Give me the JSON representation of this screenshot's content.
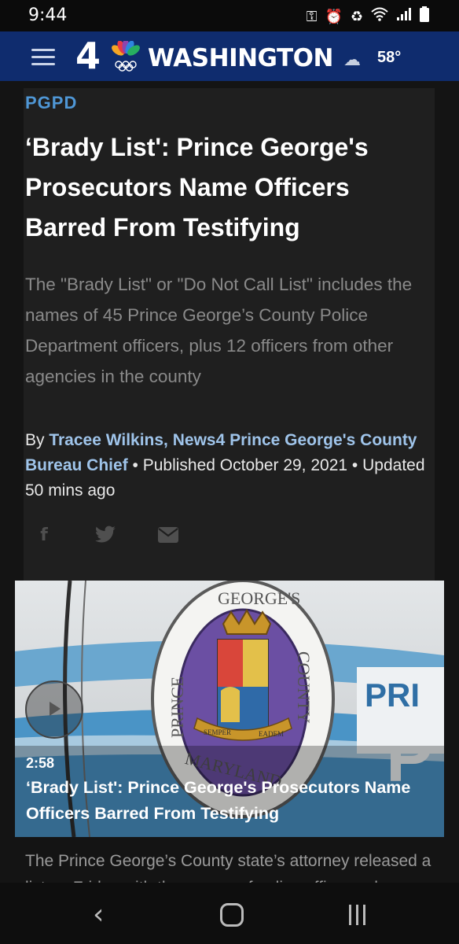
{
  "status_bar": {
    "time": "9:44",
    "icons": [
      "key-icon",
      "alarm-icon",
      "battery-saver-icon",
      "wifi-icon",
      "signal-icon",
      "battery-icon"
    ]
  },
  "header": {
    "logo_number": "4",
    "logo_text": "WASHINGTON",
    "weather_icon": "cloud-icon",
    "temperature": "58°"
  },
  "article": {
    "tag": "PGPD",
    "headline": "‘Brady List': Prince George's Prosecutors Name Officers Barred From Testifying",
    "summary": "The \"Brady List\" or \"Do Not Call List\" includes the names of 45 Prince George’s County Police Department officers, plus 12 officers from other agencies in the county",
    "byline_prefix": "By ",
    "author": "Tracee Wilkins, News4 Prince George's County Bureau Chief",
    "sep1": " • ",
    "published": "Published October 29, 2021",
    "sep2": " • ",
    "updated": "Updated 50 mins ago"
  },
  "share": {
    "facebook": "f",
    "twitter": "🐦",
    "email": "✉"
  },
  "video": {
    "duration": "2:58",
    "title": "‘Brady List': Prince George's Prosecutors Name Officers Barred From Testifying",
    "seal_top": "GEORGE'S",
    "seal_left": "PRINCE",
    "seal_right": "COUNTY",
    "seal_bottom": "MARYLAND",
    "seal_motto_left": "SEMPER",
    "seal_motto_right": "EADEM",
    "car_text_1": "PRI",
    "car_text_2": "P"
  },
  "body_text": "The Prince George’s County state’s attorney released a list on Friday with the names of police officers who a judge will"
}
